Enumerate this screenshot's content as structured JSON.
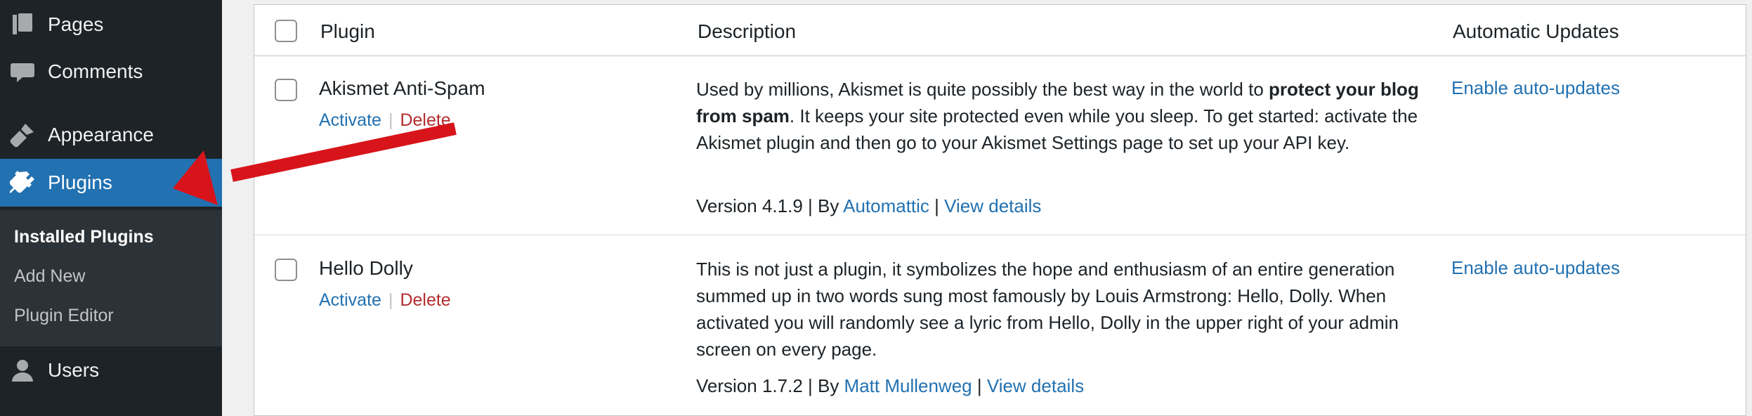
{
  "sidebar": {
    "items": [
      {
        "label": "Pages",
        "icon": "pages-icon"
      },
      {
        "label": "Comments",
        "icon": "comments-icon"
      },
      {
        "label": "Appearance",
        "icon": "appearance-icon"
      },
      {
        "label": "Plugins",
        "icon": "plugins-icon",
        "current": true
      },
      {
        "label": "Users",
        "icon": "users-icon"
      }
    ],
    "submenu": [
      "Installed Plugins",
      "Add New",
      "Plugin Editor"
    ]
  },
  "table": {
    "headers": {
      "plugin": "Plugin",
      "description": "Description",
      "auto_updates": "Automatic Updates"
    },
    "rows": [
      {
        "name": "Akismet Anti-Spam",
        "activate": "Activate",
        "delete": "Delete",
        "desc_before": "Used by millions, Akismet is quite possibly the best way in the world to ",
        "desc_bold": "protect your blog from spam",
        "desc_after": ". It keeps your site protected even while you sleep. To get started: activate the Akismet plugin and then go to your Akismet Settings page to set up your API key.",
        "version": "Version 4.1.9 | By ",
        "author": "Automattic",
        "meta_sep": " | ",
        "view_details": "View details",
        "auto_update": "Enable auto-updates"
      },
      {
        "name": "Hello Dolly",
        "activate": "Activate",
        "delete": "Delete",
        "desc": "This is not just a plugin, it symbolizes the hope and enthusiasm of an entire generation summed up in two words sung most famously by Louis Armstrong: Hello, Dolly. When activated you will randomly see a lyric from Hello, Dolly in the upper right of your admin screen on every page.",
        "version": "Version 1.7.2 | By ",
        "author": "Matt Mullenweg",
        "meta_sep": " | ",
        "view_details": "View details",
        "auto_update": "Enable auto-updates"
      }
    ]
  },
  "colors": {
    "sidebar_bg": "#1d2327",
    "submenu_bg": "#2c3338",
    "accent": "#2271b1",
    "delete": "#b32d2e",
    "annotation_arrow": "#d8141b"
  }
}
